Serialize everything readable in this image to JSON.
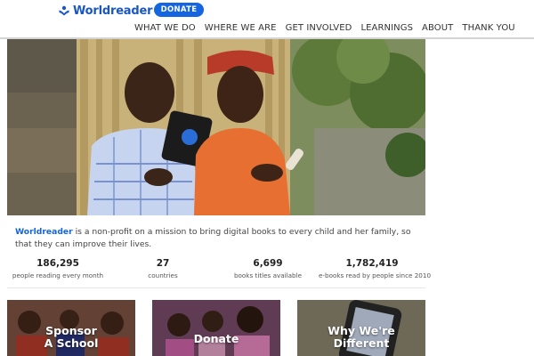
{
  "header": {
    "logo_text": "Worldreader",
    "donate_label": "DONATE",
    "nav": [
      "WHAT WE DO",
      "WHERE WE ARE",
      "GET INVOLVED",
      "LEARNINGS",
      "ABOUT",
      "THANK YOU"
    ]
  },
  "intro": {
    "brand": "Worldreader",
    "text": " is a non-profit on a mission to bring digital books to every child and her family, so that they can improve their lives."
  },
  "stats": [
    {
      "value": "186,295",
      "label": "people reading every month"
    },
    {
      "value": "27",
      "label": "countries"
    },
    {
      "value": "6,699",
      "label": "books titles available"
    },
    {
      "value": "1,782,419",
      "label": "e-books read by people since 2010"
    }
  ],
  "cards": [
    {
      "title": "Sponsor\nA School"
    },
    {
      "title": "Donate"
    },
    {
      "title": "Why We're\nDifferent"
    }
  ],
  "colors": {
    "brand_blue": "#1565e0",
    "logo_blue": "#1a56c4"
  },
  "icons": {
    "logo": "worldreader-logo-icon"
  }
}
